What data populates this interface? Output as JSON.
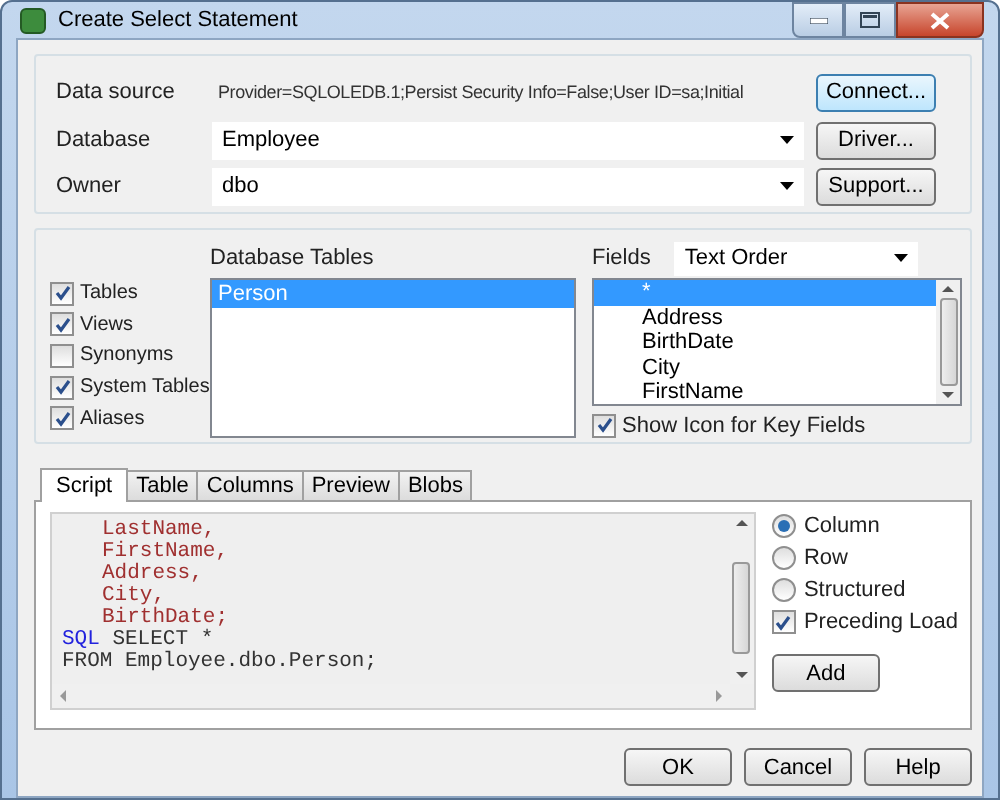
{
  "window": {
    "title": "Create Select Statement"
  },
  "connection": {
    "data_source": {
      "label": "Data source",
      "value": "Provider=SQLOLEDB.1;Persist Security Info=False;User ID=sa;Initial"
    },
    "database": {
      "label": "Database",
      "value": "Employee"
    },
    "owner": {
      "label": "Owner",
      "value": "dbo"
    }
  },
  "connection_buttons": [
    "Connect...",
    "Driver...",
    "Support..."
  ],
  "object_types": [
    {
      "label": "Tables",
      "checked": true
    },
    {
      "label": "Views",
      "checked": true
    },
    {
      "label": "Synonyms",
      "checked": false
    },
    {
      "label": "System Tables",
      "checked": true
    },
    {
      "label": "Aliases",
      "checked": true
    }
  ],
  "database_tables": {
    "heading": "Database Tables",
    "items": [
      {
        "label": "Person",
        "selected": true
      }
    ]
  },
  "fields": {
    "label": "Fields",
    "sort": "Text Order",
    "items": [
      {
        "label": "*",
        "selected": true
      },
      {
        "label": "Address",
        "selected": false
      },
      {
        "label": "BirthDate",
        "selected": false
      },
      {
        "label": "City",
        "selected": false
      },
      {
        "label": "FirstName",
        "selected": false
      }
    ],
    "show_key_icon": {
      "label": "Show Icon for Key Fields",
      "checked": true
    }
  },
  "tabs": [
    {
      "label": "Script",
      "selected": true
    },
    {
      "label": "Table",
      "selected": false
    },
    {
      "label": "Columns",
      "selected": false
    },
    {
      "label": "Preview",
      "selected": false
    },
    {
      "label": "Blobs",
      "selected": false
    }
  ],
  "script": [
    {
      "kind": "field",
      "text": "LastName,"
    },
    {
      "kind": "field",
      "text": "FirstName,"
    },
    {
      "kind": "field",
      "text": "Address,"
    },
    {
      "kind": "field",
      "text": "City,"
    },
    {
      "kind": "field",
      "text": "BirthDate;"
    },
    {
      "kind": "statement",
      "keyword": "SQL",
      "text": "SELECT *"
    },
    {
      "kind": "plain",
      "text": "FROM Employee.dbo.Person;"
    }
  ],
  "load_options": [
    {
      "kind": "radio",
      "label": "Column",
      "selected": true
    },
    {
      "kind": "radio",
      "label": "Row",
      "selected": false
    },
    {
      "kind": "radio",
      "label": "Structured",
      "selected": false
    },
    {
      "kind": "checkbox",
      "label": "Preceding Load",
      "checked": true
    }
  ],
  "add_button": "Add",
  "dialog_buttons": [
    "OK",
    "Cancel",
    "Help"
  ]
}
